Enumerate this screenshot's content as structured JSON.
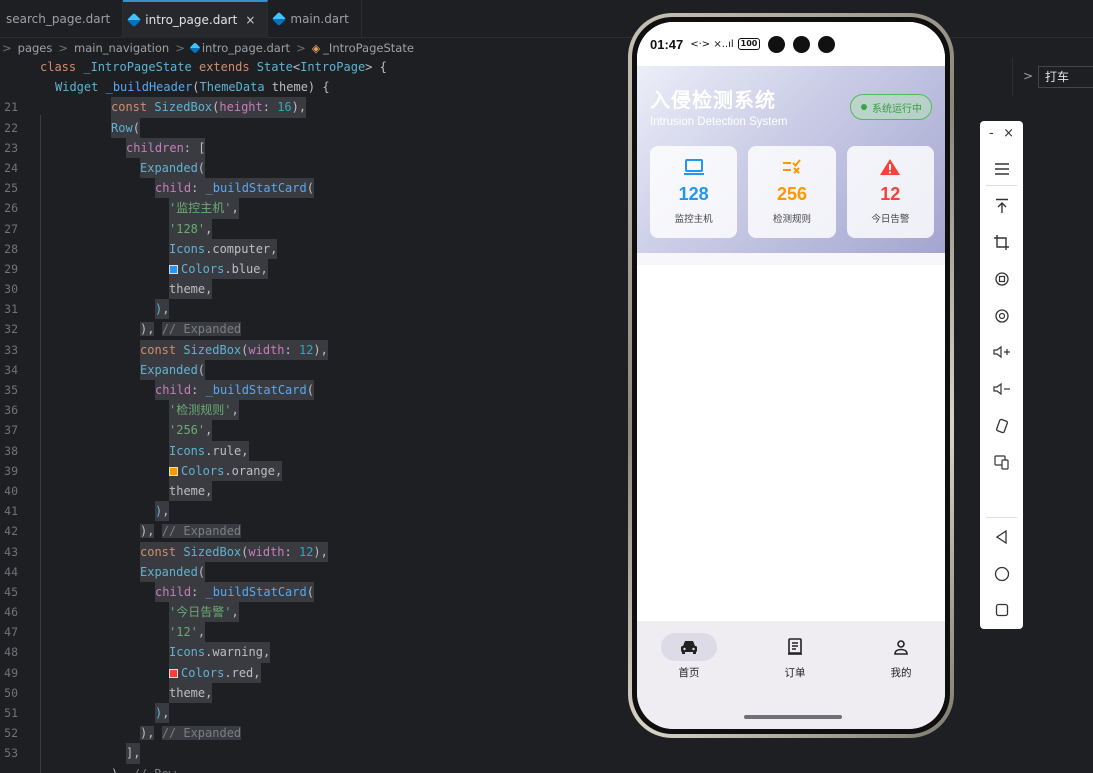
{
  "editor": {
    "tabs": [
      {
        "label": "search_page.dart",
        "active": false
      },
      {
        "label": "intro_page.dart",
        "active": true
      },
      {
        "label": "main.dart",
        "active": false
      }
    ],
    "tab_close": "×",
    "breadcrumb": [
      "pages",
      "main_navigation",
      "intro_page.dart",
      "_IntroPageState"
    ],
    "sticky": [
      "class _IntroPageState extends State<IntroPage> {",
      "Widget _buildHeader(ThemeData theme) {"
    ],
    "line_numbers": [
      "21",
      "22",
      "23",
      "24",
      "25",
      "26",
      "27",
      "28",
      "29",
      "30",
      "31",
      "32",
      "33",
      "34",
      "35",
      "36",
      "37",
      "38",
      "39",
      "40",
      "41",
      "42",
      "43",
      "44",
      "45",
      "46",
      "47",
      "48",
      "49",
      "50",
      "51",
      "52",
      "53"
    ],
    "lines": [
      "const SizedBox(height: 16),",
      "Row(",
      "children: [",
      "Expanded(",
      "child: _buildStatCard(",
      "'监控主机',",
      "'128',",
      "Icons.computer,",
      "Colors.blue,",
      "theme,",
      "),",
      "), // Expanded",
      "const SizedBox(width: 12),",
      "Expanded(",
      "child: _buildStatCard(",
      "'检测规则',",
      "'256',",
      "Icons.rule,",
      "Colors.orange,",
      "theme,",
      "),",
      "), // Expanded",
      "const SizedBox(width: 12),",
      "Expanded(",
      "child: _buildStatCard(",
      "'今日告警',",
      "'12',",
      "Icons.warning,",
      "Colors.red,",
      "theme,",
      "),",
      "), // Expanded",
      "],",
      "), // Row"
    ],
    "search_value": "打车"
  },
  "emulator_toolbar": {
    "minimize": "-",
    "close": "×",
    "tools": [
      "menu-icon",
      "rotate-to-top-icon",
      "crop-icon",
      "rotate-left-icon",
      "rotate-right-icon",
      "volume-up-icon",
      "volume-down-icon",
      "shake-icon",
      "multi-screen-icon",
      "back-icon",
      "home-icon",
      "recents-icon"
    ]
  },
  "phone": {
    "status": {
      "time": "01:47",
      "signal": "<·> ×..ıl",
      "battery": "100"
    },
    "app": {
      "title": "入侵检测系统",
      "subtitle": "Intrusion Detection System",
      "status_badge": "系统运行中",
      "stats": [
        {
          "value": "128",
          "label": "监控主机",
          "icon": "computer-icon",
          "color": "#2196f3"
        },
        {
          "value": "256",
          "label": "检测规则",
          "icon": "rule-icon",
          "color": "#ff9800"
        },
        {
          "value": "12",
          "label": "今日告警",
          "icon": "warning-icon",
          "color": "#f44336"
        }
      ]
    },
    "nav": [
      {
        "label": "首页",
        "icon": "car-icon",
        "active": true
      },
      {
        "label": "订单",
        "icon": "receipt-icon",
        "active": false
      },
      {
        "label": "我的",
        "icon": "person-icon",
        "active": false
      }
    ]
  }
}
